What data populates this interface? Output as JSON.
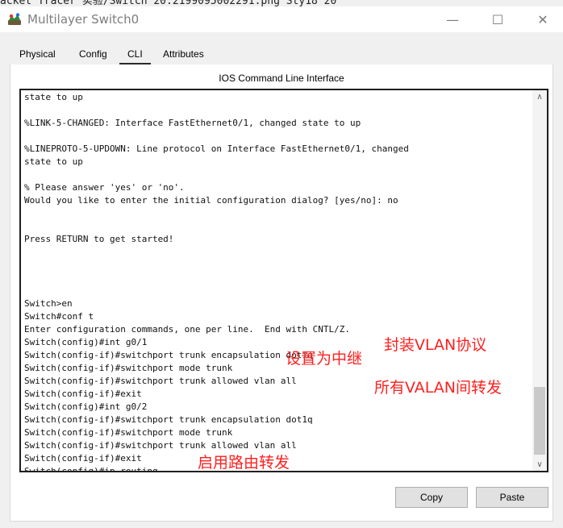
{
  "top_fragment": "acket Tracer 实验/Switch 20.2199095002291.png  Sty18  20",
  "window": {
    "title": "Multilayer Switch0",
    "minimize_glyph": "—",
    "maximize_glyph": "☐",
    "close_glyph": "✕"
  },
  "tabs": [
    {
      "label": "Physical"
    },
    {
      "label": "Config"
    },
    {
      "label": "CLI"
    },
    {
      "label": "Attributes"
    }
  ],
  "panel_header": "IOS Command Line Interface",
  "terminal": {
    "text": "state to up\n\n%LINK-5-CHANGED: Interface FastEthernet0/1, changed state to up\n\n%LINEPROTO-5-UPDOWN: Line protocol on Interface FastEthernet0/1, changed\nstate to up\n\n% Please answer 'yes' or 'no'.\nWould you like to enter the initial configuration dialog? [yes/no]: no\n\n\nPress RETURN to get started!\n\n\n\n\nSwitch>en\nSwitch#conf t\nEnter configuration commands, one per line.  End with CNTL/Z.\nSwitch(config)#int g0/1\nSwitch(config-if)#switchport trunk encapsulation dot1q\nSwitch(config-if)#switchport mode trunk\nSwitch(config-if)#switchport trunk allowed vlan all\nSwitch(config-if)#exit\nSwitch(config)#int g0/2\nSwitch(config-if)#switchport trunk encapsulation dot1q\nSwitch(config-if)#switchport mode trunk\nSwitch(config-if)#switchport trunk allowed vlan all\nSwitch(config-if)#exit\nSwitch(config)#ip routing\nSwitch(config)#"
  },
  "annotations": {
    "encapsulation": "封装VLAN协议",
    "trunk": "设置为中继",
    "allowed": "所有VALAN间转发",
    "routing": "启用路由转发"
  },
  "scrollbar": {
    "up_glyph": "∧",
    "down_glyph": "∨"
  },
  "buttons": {
    "copy": "Copy",
    "paste": "Paste"
  },
  "colors": {
    "annotation": "#ff1f1f",
    "selected_tab_underline": "#2b2b2b"
  }
}
